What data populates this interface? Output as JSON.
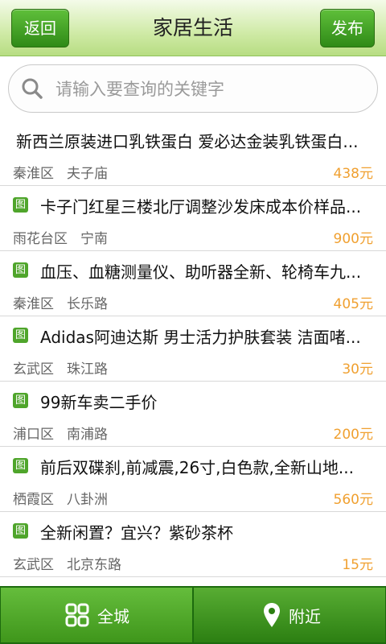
{
  "header": {
    "back_label": "返回",
    "title": "家居生活",
    "post_label": "发布"
  },
  "search": {
    "placeholder": "请输入要查询的关键字",
    "value": ""
  },
  "listings": [
    {
      "has_image": false,
      "title": "新西兰原装进口乳铁蛋白 爱必达金装乳铁蛋白...",
      "district": "秦淮区",
      "area": "夫子庙",
      "price": "438元"
    },
    {
      "has_image": true,
      "title": "卡子门红星三楼北厅调整沙发床成本价样品...",
      "district": "雨花台区",
      "area": "宁南",
      "price": "900元"
    },
    {
      "has_image": true,
      "title": "血压、血糖测量仪、助听器全新、轮椅车九...",
      "district": "秦淮区",
      "area": "长乐路",
      "price": "405元"
    },
    {
      "has_image": true,
      "title": "Adidas阿迪达斯 男士活力护肤套装 洁面啫...",
      "district": "玄武区",
      "area": "珠江路",
      "price": "30元"
    },
    {
      "has_image": true,
      "title": "99新车卖二手价",
      "district": "浦口区",
      "area": "南浦路",
      "price": "200元"
    },
    {
      "has_image": true,
      "title": "前后双碟刹,前减震,26寸,白色款,全新山地...",
      "district": "栖霞区",
      "area": "八卦洲",
      "price": "560元"
    },
    {
      "has_image": true,
      "title": "全新闲置？宜兴？紫砂茶杯",
      "district": "玄武区",
      "area": "北京东路",
      "price": "15元"
    }
  ],
  "image_tag_label": "图",
  "footer": {
    "city_label": "全城",
    "nearby_label": "附近"
  },
  "colors": {
    "accent_green": "#3f961b",
    "price_orange": "#f0a030"
  },
  "icons": {
    "search": "search-icon",
    "city": "grid-icon",
    "nearby": "location-pin-icon"
  }
}
